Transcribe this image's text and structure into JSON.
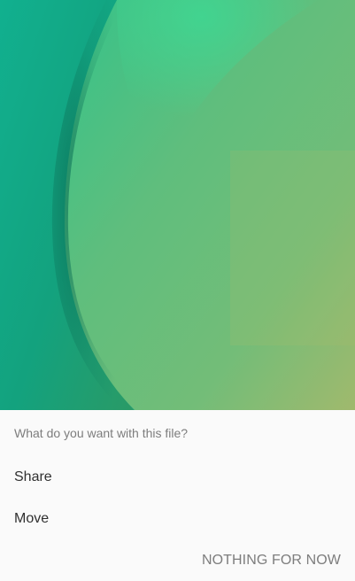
{
  "wallpaper": {
    "image_name": "abstract-green-wallpaper",
    "colors": {
      "teal": "#11a987",
      "green": "#66bf7d",
      "olive": "#a6bb68",
      "shadow": "#0b6d55"
    }
  },
  "sheet": {
    "prompt": "What do you want with this file?",
    "options": [
      {
        "label": "Share"
      },
      {
        "label": "Move"
      }
    ],
    "action_label": "NOTHING FOR NOW",
    "colors": {
      "background": "#fafafa",
      "option_text": "#303030",
      "secondary_text": "#7d7d7d"
    }
  }
}
